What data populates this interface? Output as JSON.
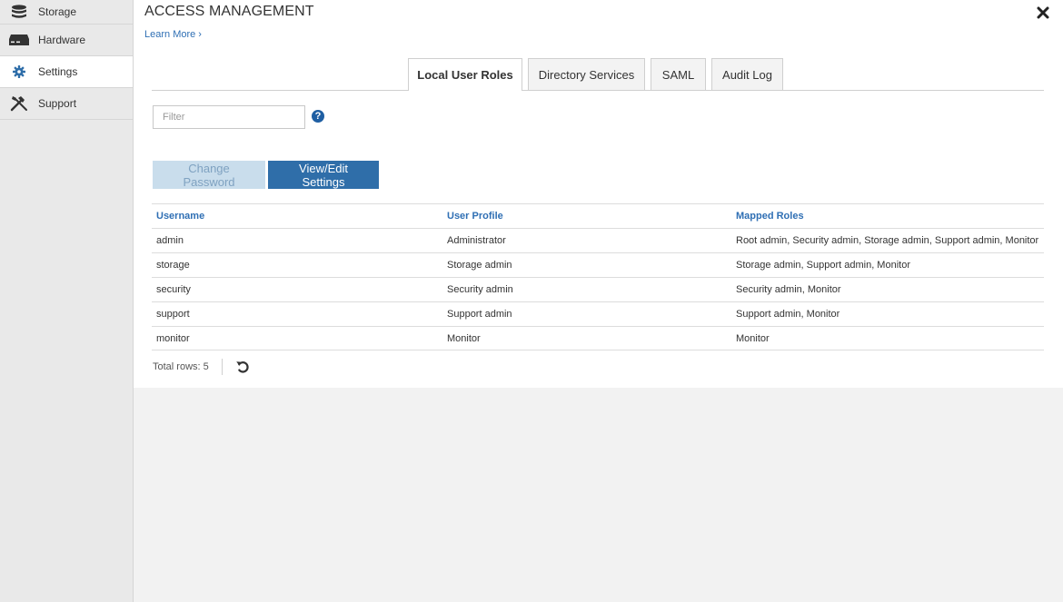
{
  "sidebar": {
    "items": [
      {
        "label": "Storage",
        "icon": "database-icon"
      },
      {
        "label": "Hardware",
        "icon": "hardware-icon"
      },
      {
        "label": "Settings",
        "icon": "gear-icon"
      },
      {
        "label": "Support",
        "icon": "tools-icon"
      }
    ]
  },
  "header": {
    "title": "ACCESS MANAGEMENT",
    "learn_more": "Learn More ›"
  },
  "tabs": [
    {
      "label": "Local User Roles"
    },
    {
      "label": "Directory Services"
    },
    {
      "label": "SAML"
    },
    {
      "label": "Audit Log"
    }
  ],
  "filter": {
    "placeholder": "Filter",
    "help_glyph": "?"
  },
  "buttons": {
    "change_password": "Change Password",
    "view_edit": "View/Edit Settings"
  },
  "table": {
    "columns": [
      "Username",
      "User Profile",
      "Mapped Roles"
    ],
    "rows": [
      [
        "admin",
        "Administrator",
        "Root admin, Security admin, Storage admin, Support admin, Monitor"
      ],
      [
        "storage",
        "Storage admin",
        "Storage admin, Support admin, Monitor"
      ],
      [
        "security",
        "Security admin",
        "Security admin, Monitor"
      ],
      [
        "support",
        "Support admin",
        "Support admin, Monitor"
      ],
      [
        "monitor",
        "Monitor",
        "Monitor"
      ]
    ]
  },
  "footer": {
    "total_rows": "Total rows: 5"
  },
  "colors": {
    "accent": "#2f6ea9",
    "link": "#2f6fb4",
    "sidebar_bg": "#e9e9e9"
  }
}
